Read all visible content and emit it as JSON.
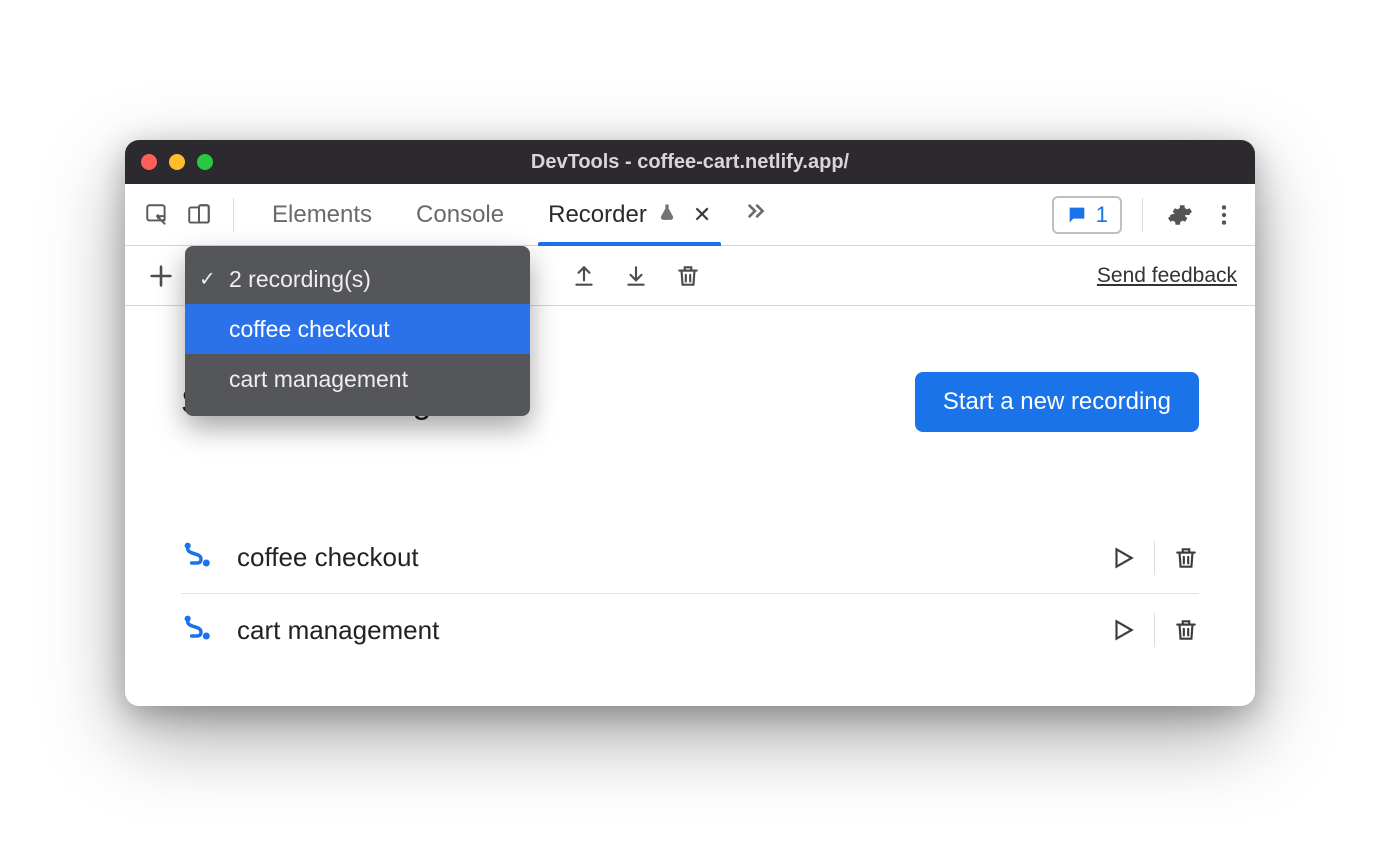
{
  "window": {
    "title": "DevTools - coffee-cart.netlify.app/"
  },
  "tabs": {
    "elements": "Elements",
    "console": "Console",
    "recorder": "Recorder"
  },
  "messages": {
    "count": "1"
  },
  "toolbar": {
    "feedback": "Send feedback"
  },
  "dropdown": {
    "summary": "2 recording(s)",
    "item_selected": "coffee checkout",
    "item_other": "cart management"
  },
  "page": {
    "title": "Saved recordings",
    "start_button": "Start a new recording"
  },
  "recordings": {
    "row0": "coffee checkout",
    "row1": "cart management"
  }
}
